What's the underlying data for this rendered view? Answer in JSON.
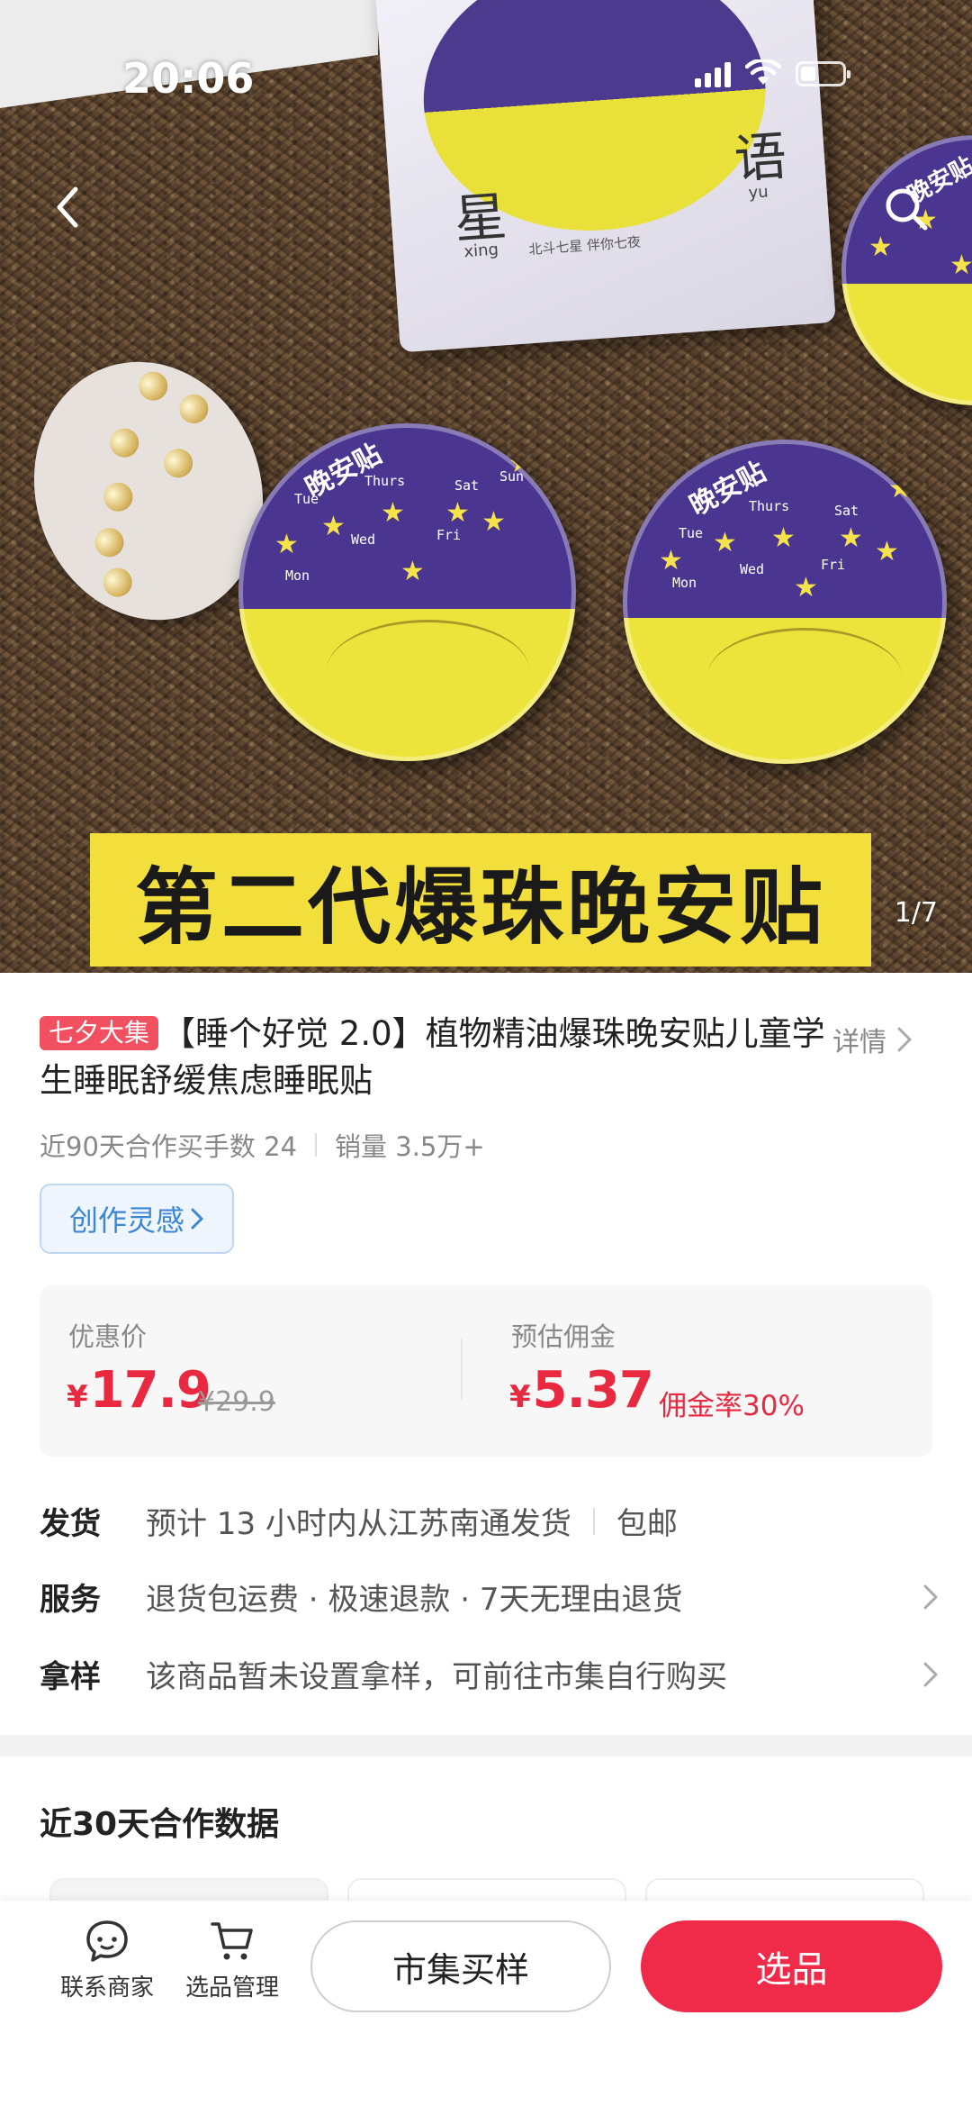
{
  "status_bar": {
    "time": "20:06"
  },
  "hero": {
    "counter": "1/7",
    "banner_text": "第二代爆珠晚安贴",
    "box": {
      "char_left": "星",
      "pinyin_left": "xing",
      "char_right": "语",
      "pinyin_right": "yu",
      "subtitle": "北斗七星 伴你七夜"
    },
    "disc_label": "晚安贴",
    "days": [
      "Mon",
      "Tue",
      "Wed",
      "Thurs",
      "Fri",
      "Sat",
      "Sun"
    ]
  },
  "product": {
    "badge": "七夕大集",
    "title": "【睡个好觉 2.0】植物精油爆珠晚安贴儿童学生睡眠舒缓焦虑睡眠贴",
    "detail_label": "详情",
    "stats_buyers": "近90天合作买手数 24",
    "stats_sales": "销量 3.5万+",
    "inspire_label": "创作灵感"
  },
  "price_card": {
    "price_label": "优惠价",
    "price_currency": "¥",
    "price": "17.9",
    "original_price": "¥29.9",
    "commission_label": "预估佣金",
    "commission_currency": "¥",
    "commission": "5.37",
    "commission_rate": "佣金率30%"
  },
  "info_rows": {
    "shipping": {
      "key": "发货",
      "value": "预计 13 小时内从江苏南通发货",
      "extra": "包邮"
    },
    "service": {
      "key": "服务",
      "value": "退货包运费 · 极速退款 · 7天无理由退货"
    },
    "sample": {
      "key": "拿样",
      "value": "该商品暂未设置拿样，可前往市集自行购买"
    }
  },
  "coop_section": {
    "title": "近30天合作数据"
  },
  "bottom_bar": {
    "contact_label": "联系商家",
    "manage_label": "选品管理",
    "buy_sample_label": "市集买样",
    "select_label": "选品"
  },
  "colors": {
    "accent_red": "#ef2b49",
    "price_red": "#e8293f",
    "link_blue": "#3c86d8",
    "banner_yellow": "#f3df3c",
    "disc_purple": "#4a3690"
  }
}
